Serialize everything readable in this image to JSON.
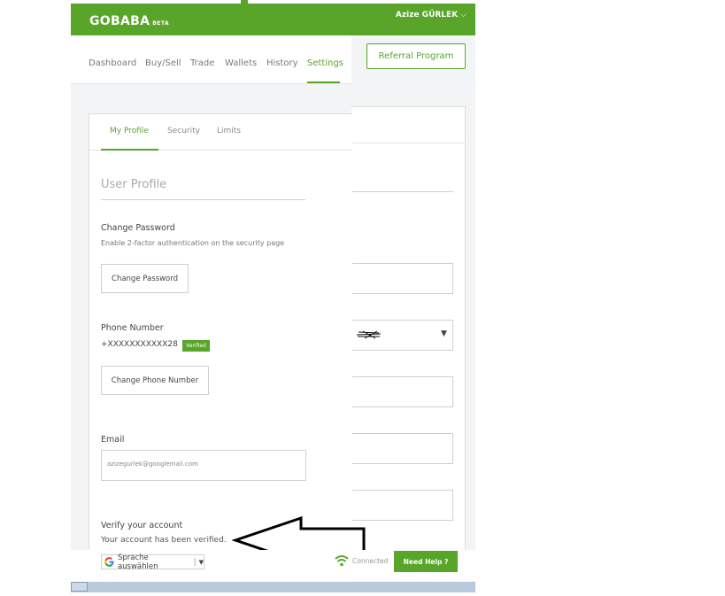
{
  "header": {
    "logo_text": "GOBABA",
    "logo_badge": "BETA",
    "user_name": "Azize GÜRLEK",
    "user_chevron": "⌵",
    "referral_label": "Referral Program"
  },
  "nav": {
    "items": [
      {
        "label": "Dashboard"
      },
      {
        "label": "Buy/Sell"
      },
      {
        "label": "Trade"
      },
      {
        "label": "Wallets"
      },
      {
        "label": "History"
      },
      {
        "label": "Settings"
      }
    ],
    "active": "Settings"
  },
  "tabs": {
    "items": [
      {
        "label": "My Profile"
      },
      {
        "label": "Security"
      },
      {
        "label": "Limits"
      }
    ],
    "active": "My Profile"
  },
  "profile": {
    "section_title": "User Profile",
    "password": {
      "label": "Change Password",
      "hint": "Enable 2-factor authentication on the security page",
      "button": "Change Password"
    },
    "phone": {
      "label": "Phone Number",
      "value": "+XXXXXXXXXXX28",
      "badge": "Verified",
      "button": "Change Phone Number"
    },
    "email": {
      "label": "Email",
      "value": "azizegurlek@googlemail.com"
    },
    "verify": {
      "label": "Verify your account",
      "status": "Your account has been verified."
    }
  },
  "back_panel": {
    "select_arrow": "▼"
  },
  "footer": {
    "translate_label": "Sprache auswählen",
    "translate_arrow": "▼",
    "connection_status": "Connected",
    "help_button": "Need Help ?"
  },
  "colors": {
    "brand_green": "#58a52a",
    "panel_bg": "#f2f4f5"
  },
  "icons": [
    "google-icon",
    "wifi-icon",
    "arrow-annotation-icon",
    "chevron-down-icon"
  ]
}
